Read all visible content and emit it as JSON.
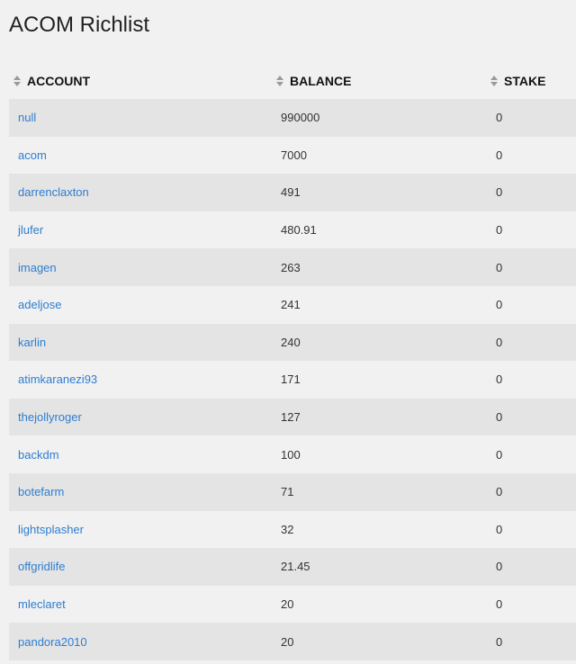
{
  "title": "ACOM Richlist",
  "columns": {
    "account": "ACCOUNT",
    "balance": "BALANCE",
    "stake": "STAKE"
  },
  "rows": [
    {
      "account": "null",
      "balance": "990000",
      "stake": "0"
    },
    {
      "account": "acom",
      "balance": "7000",
      "stake": "0"
    },
    {
      "account": "darrenclaxton",
      "balance": "491",
      "stake": "0"
    },
    {
      "account": "jlufer",
      "balance": "480.91",
      "stake": "0"
    },
    {
      "account": "imagen",
      "balance": "263",
      "stake": "0"
    },
    {
      "account": "adeljose",
      "balance": "241",
      "stake": "0"
    },
    {
      "account": "karlin",
      "balance": "240",
      "stake": "0"
    },
    {
      "account": "atimkaranezi93",
      "balance": "171",
      "stake": "0"
    },
    {
      "account": "thejollyroger",
      "balance": "127",
      "stake": "0"
    },
    {
      "account": "backdm",
      "balance": "100",
      "stake": "0"
    },
    {
      "account": "botefarm",
      "balance": "71",
      "stake": "0"
    },
    {
      "account": "lightsplasher",
      "balance": "32",
      "stake": "0"
    },
    {
      "account": "offgridlife",
      "balance": "21.45",
      "stake": "0"
    },
    {
      "account": "mleclaret",
      "balance": "20",
      "stake": "0"
    },
    {
      "account": "pandora2010",
      "balance": "20",
      "stake": "0"
    }
  ],
  "icons": {
    "sort": "sort-icon"
  },
  "colors": {
    "link": "#2e7dd1",
    "row_odd": "#e4e4e4",
    "row_even": "#f1f1f1"
  }
}
